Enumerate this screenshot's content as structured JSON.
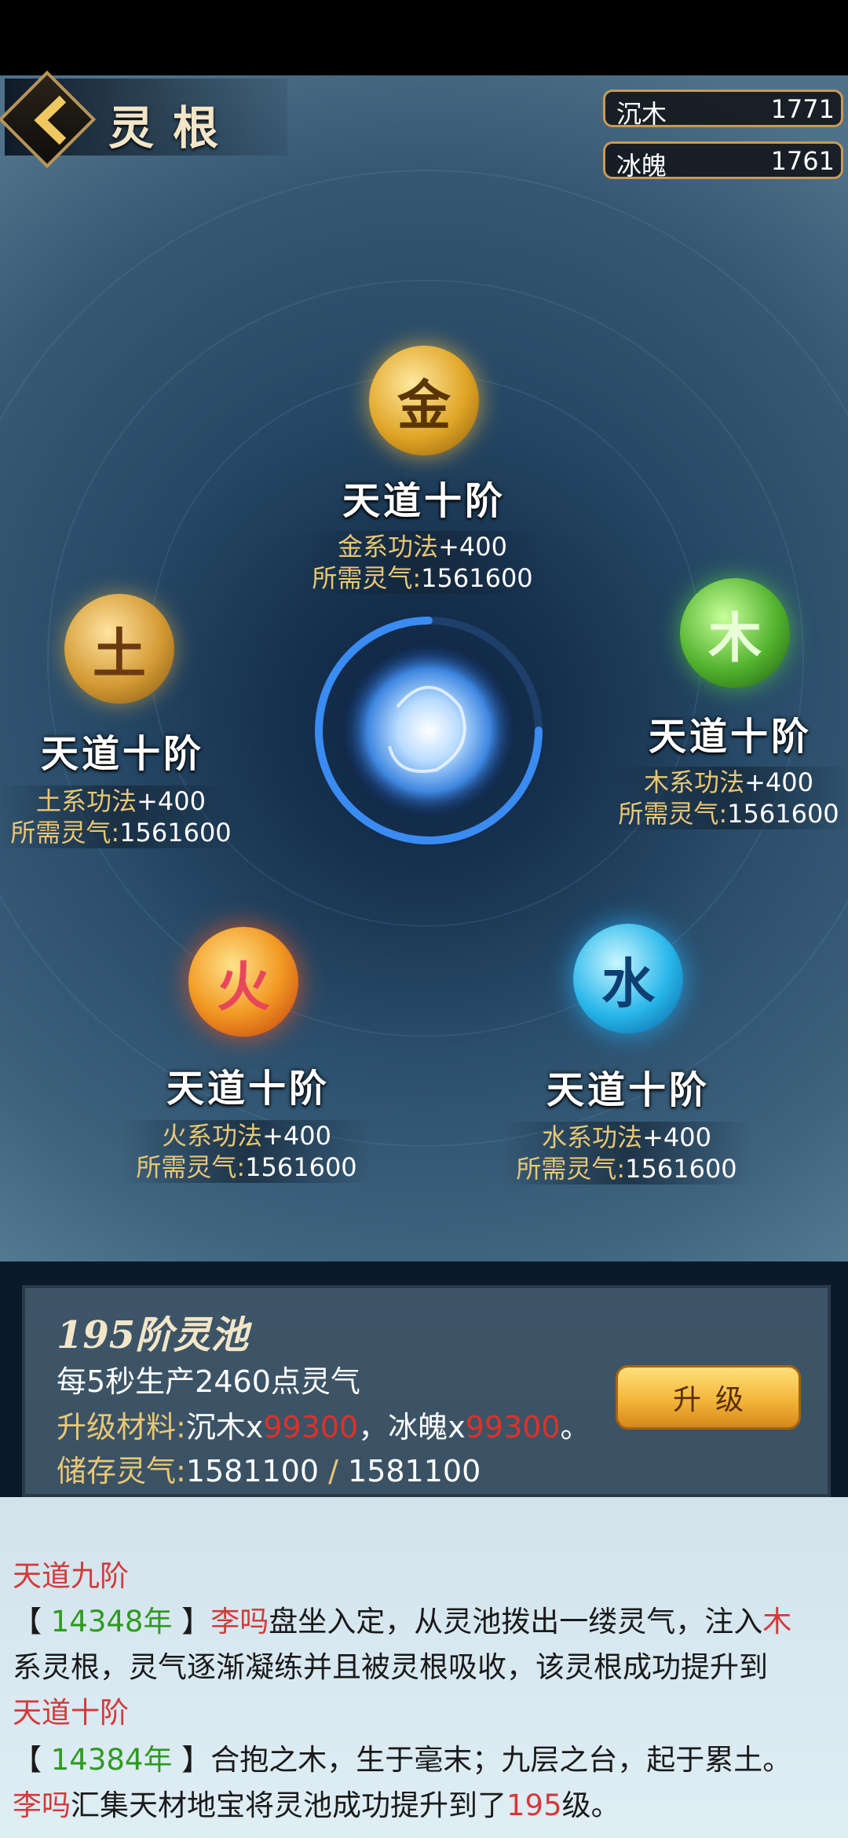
{
  "header": {
    "title": "灵根"
  },
  "resources": [
    {
      "name": "沉木",
      "value": "1771"
    },
    {
      "name": "冰魄",
      "value": "1761"
    }
  ],
  "elements": [
    {
      "glyph": "金",
      "rank": "天道十阶",
      "bonus_key": "金系功法",
      "bonus_val": "+400",
      "cost_key": "所需灵气:",
      "cost_val": "1561600"
    },
    {
      "glyph": "土",
      "rank": "天道十阶",
      "bonus_key": "土系功法",
      "bonus_val": "+400",
      "cost_key": "所需灵气:",
      "cost_val": "1561600"
    },
    {
      "glyph": "木",
      "rank": "天道十阶",
      "bonus_key": "木系功法",
      "bonus_val": "+400",
      "cost_key": "所需灵气:",
      "cost_val": "1561600"
    },
    {
      "glyph": "火",
      "rank": "天道十阶",
      "bonus_key": "火系功法",
      "bonus_val": "+400",
      "cost_key": "所需灵气:",
      "cost_val": "1561600"
    },
    {
      "glyph": "水",
      "rank": "天道十阶",
      "bonus_key": "水系功法",
      "bonus_val": "+400",
      "cost_key": "所需灵气:",
      "cost_val": "1561600"
    }
  ],
  "pool": {
    "title": "195阶灵池",
    "production": "每5秒生产2460点灵气",
    "material_label": "升级材料:",
    "material_1": "沉木x",
    "material_1_qty": "99300",
    "separator": "，",
    "material_2": "冰魄x",
    "material_2_qty": "99300",
    "period": "。",
    "storage_label": "储存灵气:",
    "storage_current": "1581100",
    "storage_slash": " / ",
    "storage_max": "1581100",
    "upgrade_label": "升级"
  },
  "log": {
    "l1": "天道九阶",
    "l2_open": "【 ",
    "l2_year": "14348年",
    "l2_close": " 】",
    "l2_name": "李吗",
    "l2_text": "盘坐入定，从灵池拨出一缕灵气，注入",
    "l2_elem": "木",
    "l3": "系灵根，灵气逐渐凝练并且被灵根吸收，该灵根成功提升到",
    "l4": "天道十阶",
    "l5_open": "【 ",
    "l5_year": "14384年",
    "l5_close": " 】",
    "l5_text": "合抱之木，生于毫末；九层之台，起于累土。",
    "l6_name": "李吗",
    "l6_text": "汇集天材地宝将灵池成功提升到了",
    "l6_level": "195",
    "l6_end": "级。"
  }
}
